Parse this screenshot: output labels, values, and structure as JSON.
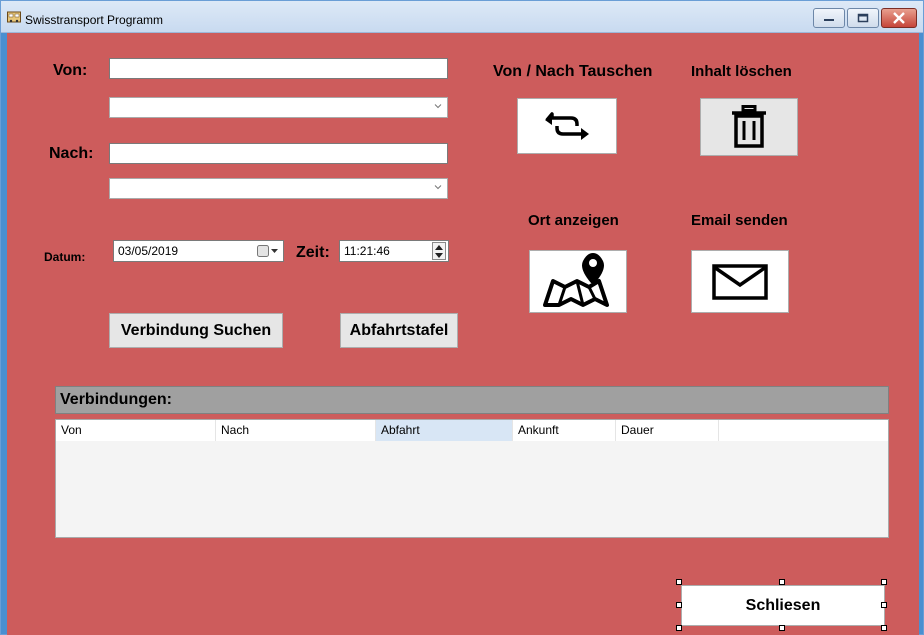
{
  "window": {
    "title": "Swisstransport Programm"
  },
  "form": {
    "von_label": "Von:",
    "nach_label": "Nach:",
    "von_value": "",
    "nach_value": "",
    "datum_label": "Datum:",
    "datum_value": "03/05/2019",
    "zeit_label": "Zeit:",
    "zeit_value": "11:21:46"
  },
  "actions": {
    "swap_label": "Von / Nach Tauschen",
    "clear_label": "Inhalt löschen",
    "show_location_label": "Ort anzeigen",
    "send_email_label": "Email senden",
    "search_button": "Verbindung Suchen",
    "departures_button": "Abfahrtstafel",
    "close_button": "Schliesen"
  },
  "icons": {
    "swap": "swap-arrows-icon",
    "clear": "trash-icon",
    "location": "map-pin-icon",
    "email": "envelope-icon"
  },
  "connections": {
    "header": "Verbindungen:",
    "columns": [
      "Von",
      "Nach",
      "Abfahrt",
      "Ankunft",
      "Dauer"
    ],
    "rows": []
  },
  "colors": {
    "client_background": "#cd5c5c",
    "selected_column": "#d8e6f5"
  }
}
